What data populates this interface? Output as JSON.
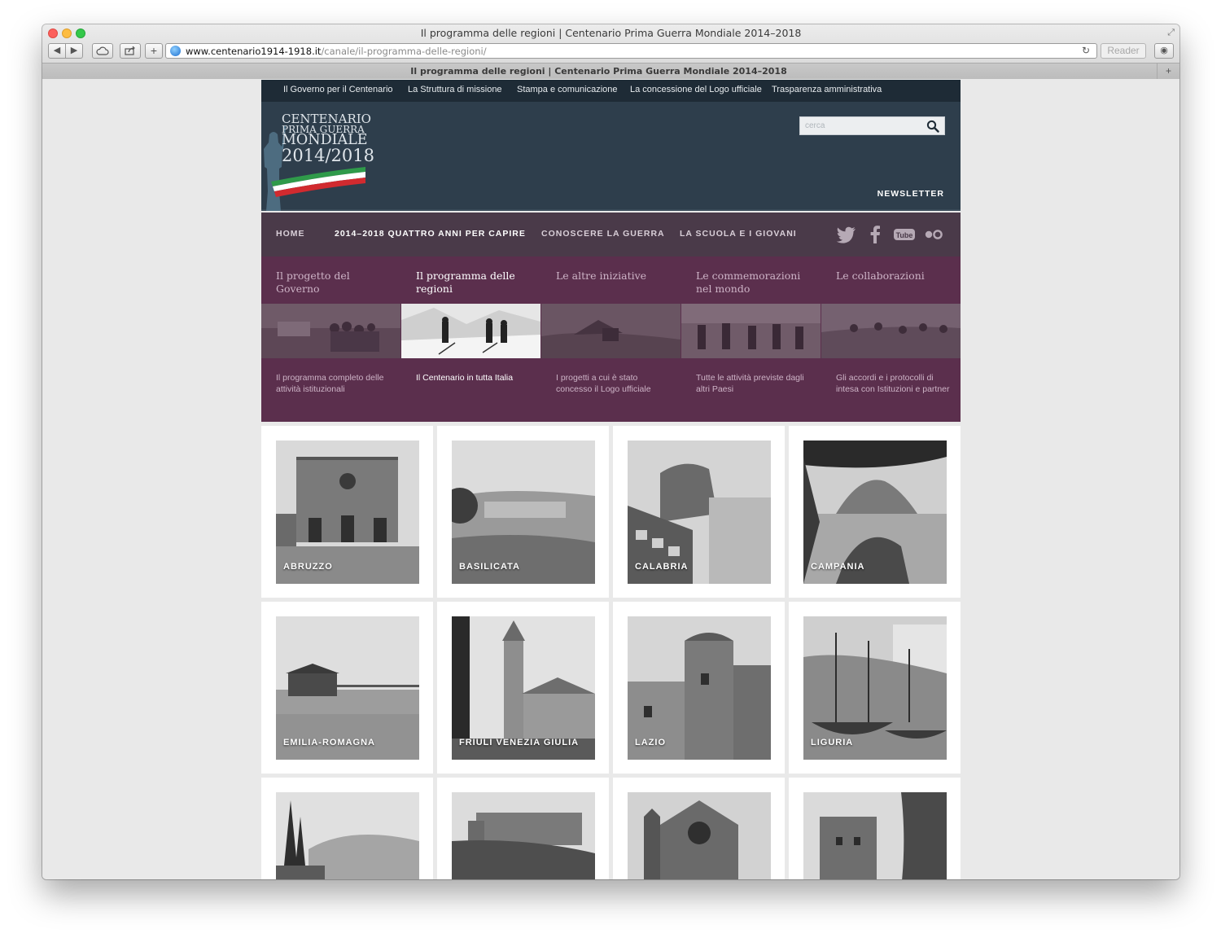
{
  "browser": {
    "window_title": "Il programma delle regioni | Centenario Prima Guerra Mondiale 2014–2018",
    "url_host": "www.centenario1914-1918.it",
    "url_path": "/canale/il-programma-delle-regioni/",
    "reader_label": "Reader",
    "tab_title": "Il programma delle regioni | Centenario Prima Guerra Mondiale 2014–2018"
  },
  "topnav": [
    "Il Governo per il Centenario",
    "La Struttura di missione",
    "Stampa e comunicazione",
    "La concessione del Logo ufficiale",
    "Trasparenza amministrativa"
  ],
  "logo": {
    "line1": "CENTENARIO",
    "line2": "PRIMA GUERRA",
    "line3": "MONDIALE",
    "line4": "2014/2018"
  },
  "search": {
    "placeholder": "cerca"
  },
  "newsletter": "NEWSLETTER",
  "mainnav": [
    "HOME",
    "2014–2018 QUATTRO ANNI PER CAPIRE",
    "CONOSCERE LA GUERRA",
    "LA SCUOLA E I GIOVANI"
  ],
  "subnav": [
    {
      "title": "Il progetto del Governo",
      "desc": "Il programma completo delle attività istituzionali"
    },
    {
      "title": "Il programma delle regioni",
      "desc": "Il Centenario in tutta Italia"
    },
    {
      "title": "Le altre iniziative",
      "desc": "I progetti a cui è stato concesso il Logo ufficiale"
    },
    {
      "title": "Le commemorazioni nel mondo",
      "desc": "Tutte le attività previste dagli altri Paesi"
    },
    {
      "title": "Le collaborazioni",
      "desc": "Gli accordi e i protocolli di intesa con Istituzioni e partner"
    }
  ],
  "regions": [
    "ABRUZZO",
    "BASILICATA",
    "CALABRIA",
    "CAMPANIA",
    "EMILIA-ROMAGNA",
    "FRIULI VENEZIA GIULIA",
    "LAZIO",
    "LIGURIA",
    "",
    "",
    "",
    ""
  ],
  "colors": {
    "topnav_bg": "#1e2b36",
    "header_bg": "#2e3e4c",
    "mainnav_bg": "#4a3a49",
    "subnav_bg": "#5b2f4d"
  }
}
